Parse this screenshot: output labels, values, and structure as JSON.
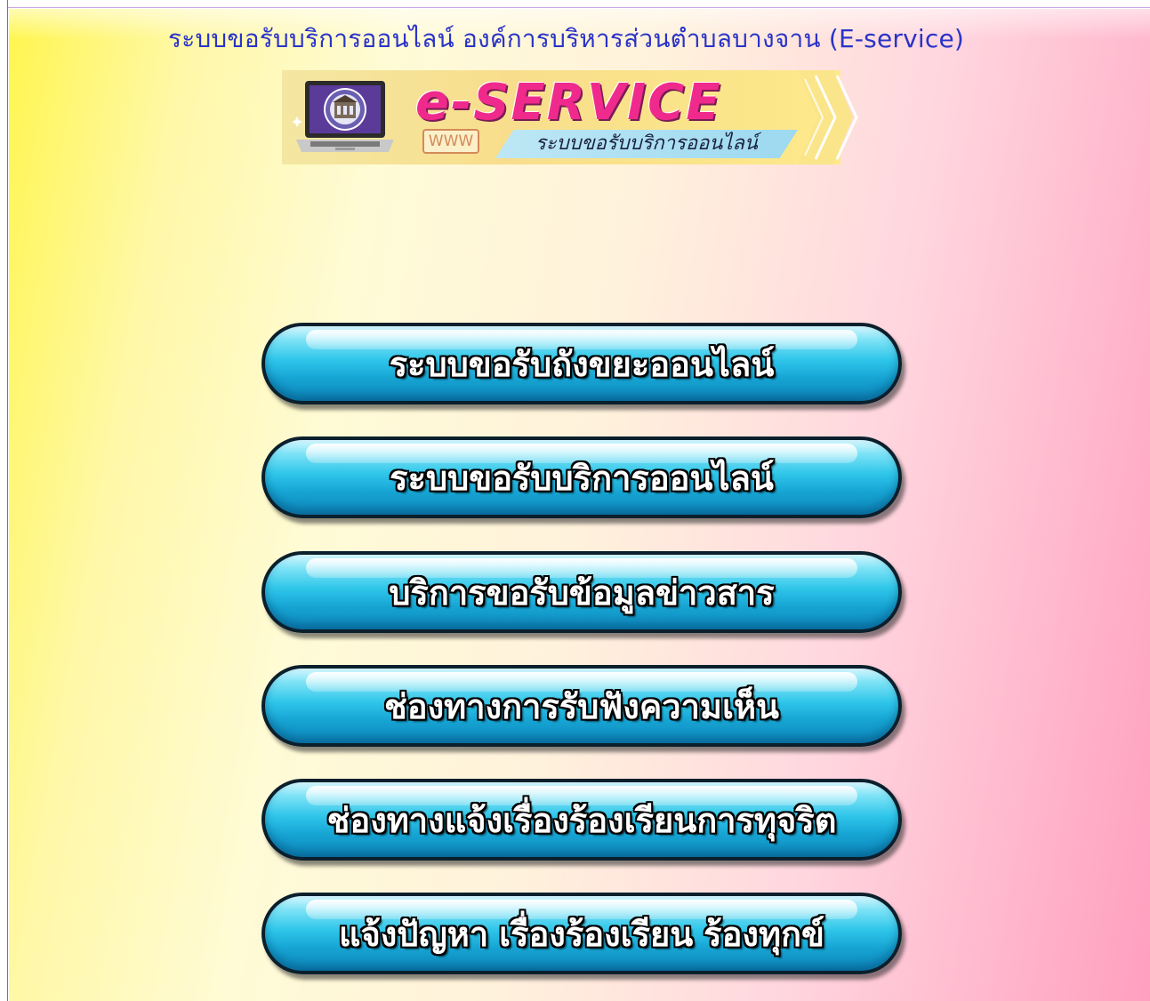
{
  "page": {
    "title": "ระบบขอรับบริการออนไลน์ องค์การบริหารส่วนตำบลบางจาน (E-service)"
  },
  "banner": {
    "logo_word": "e-SERVICE",
    "www_label": "WWW",
    "subtitle": "ระบบขอรับบริการออนไลน์",
    "laptop_icon": "laptop-emblem-icon"
  },
  "menu": {
    "items": [
      {
        "label": "ระบบขอรับถังขยะออนไลน์"
      },
      {
        "label": "ระบบขอรับบริการออนไลน์"
      },
      {
        "label": "บริการขอรับข้อมูลข่าวสาร"
      },
      {
        "label": "ช่องทางการรับฟังความเห็น"
      },
      {
        "label": "ช่องทางแจ้งเรื่องร้องเรียนการทุจริต"
      },
      {
        "label": "แจ้งปัญหา เรื่องร้องเรียน ร้องทุกข์"
      }
    ]
  },
  "colors": {
    "title_text": "#2a33c8",
    "button_top": "#7ee3f6",
    "button_bottom": "#0d86bb",
    "logo_pink": "#f02a8c",
    "bg_left": "#fff64f",
    "bg_right": "#ff9fbf"
  }
}
